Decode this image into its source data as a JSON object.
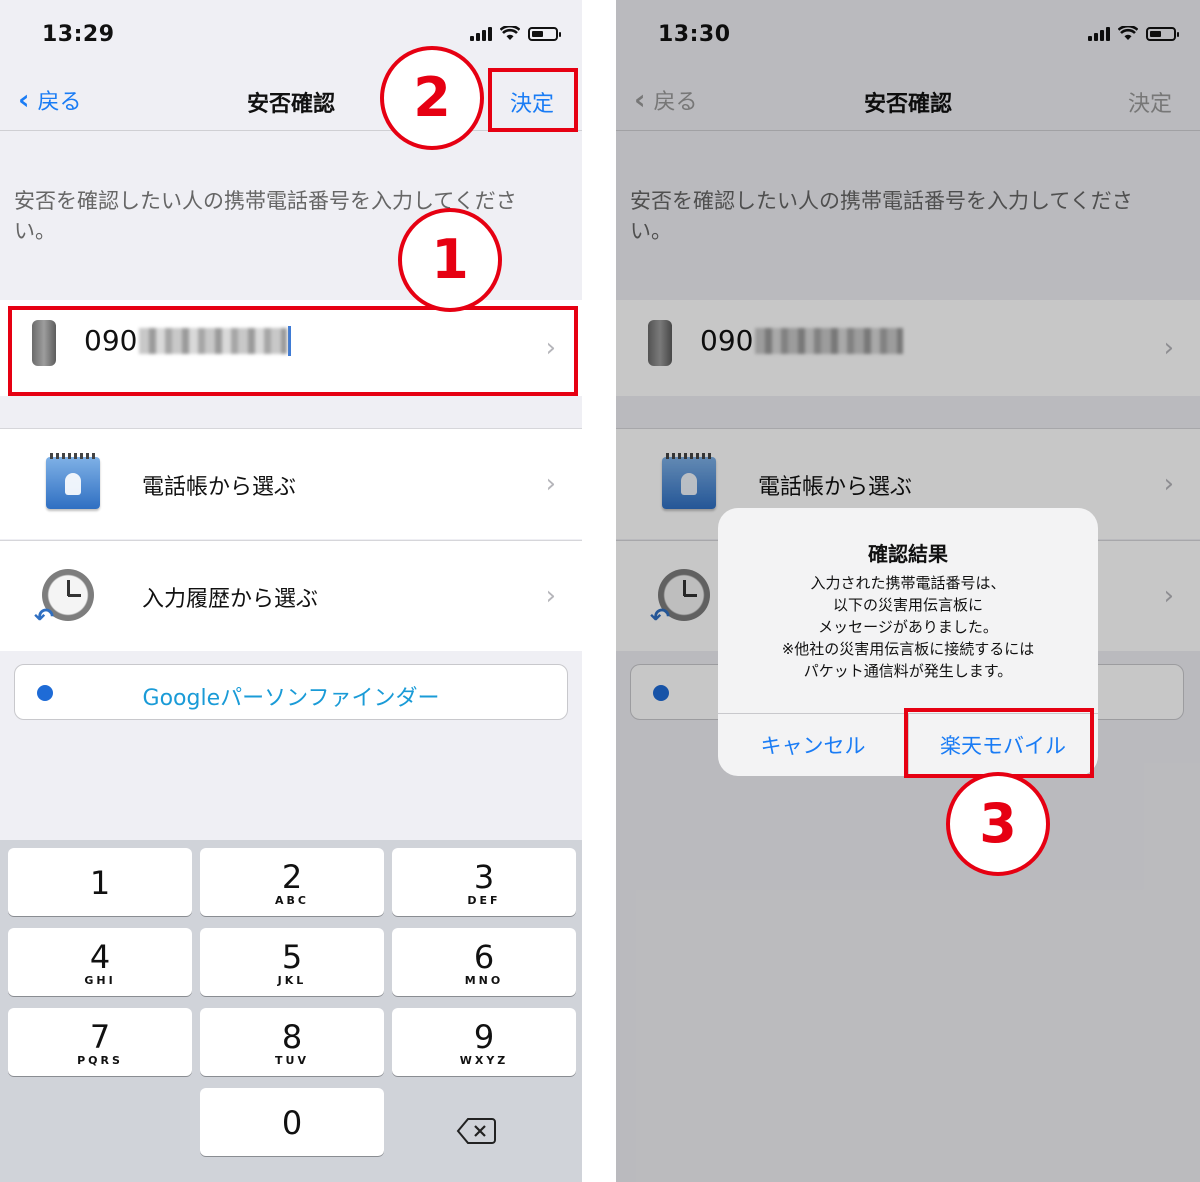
{
  "left": {
    "time": "13:29",
    "nav": {
      "back": "戻る",
      "title": "安否確認",
      "done": "決定"
    },
    "instruction": "安否を確認したい人の携帯電話番号を入力してください。",
    "phone_prefix": "090",
    "rows": [
      {
        "label": "電話帳から選ぶ",
        "icon": "contacts-icon"
      },
      {
        "label": "入力履歴から選ぶ",
        "icon": "clock-history-icon"
      }
    ],
    "google_finder": "Googleパーソンファインダー",
    "keypad": {
      "keys": [
        {
          "digit": "1",
          "letters": ""
        },
        {
          "digit": "2",
          "letters": "ABC"
        },
        {
          "digit": "3",
          "letters": "DEF"
        },
        {
          "digit": "4",
          "letters": "GHI"
        },
        {
          "digit": "5",
          "letters": "JKL"
        },
        {
          "digit": "6",
          "letters": "MNO"
        },
        {
          "digit": "7",
          "letters": "PQRS"
        },
        {
          "digit": "8",
          "letters": "TUV"
        },
        {
          "digit": "9",
          "letters": "WXYZ"
        },
        {
          "digit": "0",
          "letters": ""
        }
      ]
    },
    "markers": [
      "1",
      "2"
    ]
  },
  "right": {
    "time": "13:30",
    "nav": {
      "back": "戻る",
      "title": "安否確認",
      "done": "決定"
    },
    "instruction": "安否を確認したい人の携帯電話番号を入力してください。",
    "phone_prefix": "090",
    "rows": [
      {
        "label": "電話帳から選ぶ",
        "icon": "contacts-icon"
      }
    ],
    "alert": {
      "title": "確認結果",
      "message_lines": [
        "入力された携帯電話番号は、",
        "以下の災害用伝言板に",
        "メッセージがありました。",
        "※他社の災害用伝言板に接続するには",
        "パケット通信料が発生します。"
      ],
      "cancel": "キャンセル",
      "confirm": "楽天モバイル"
    },
    "markers": [
      "3"
    ]
  },
  "colors": {
    "accent": "#1a7cf5",
    "annotation_red": "#e60012",
    "link_teal": "#1a9bd7"
  }
}
